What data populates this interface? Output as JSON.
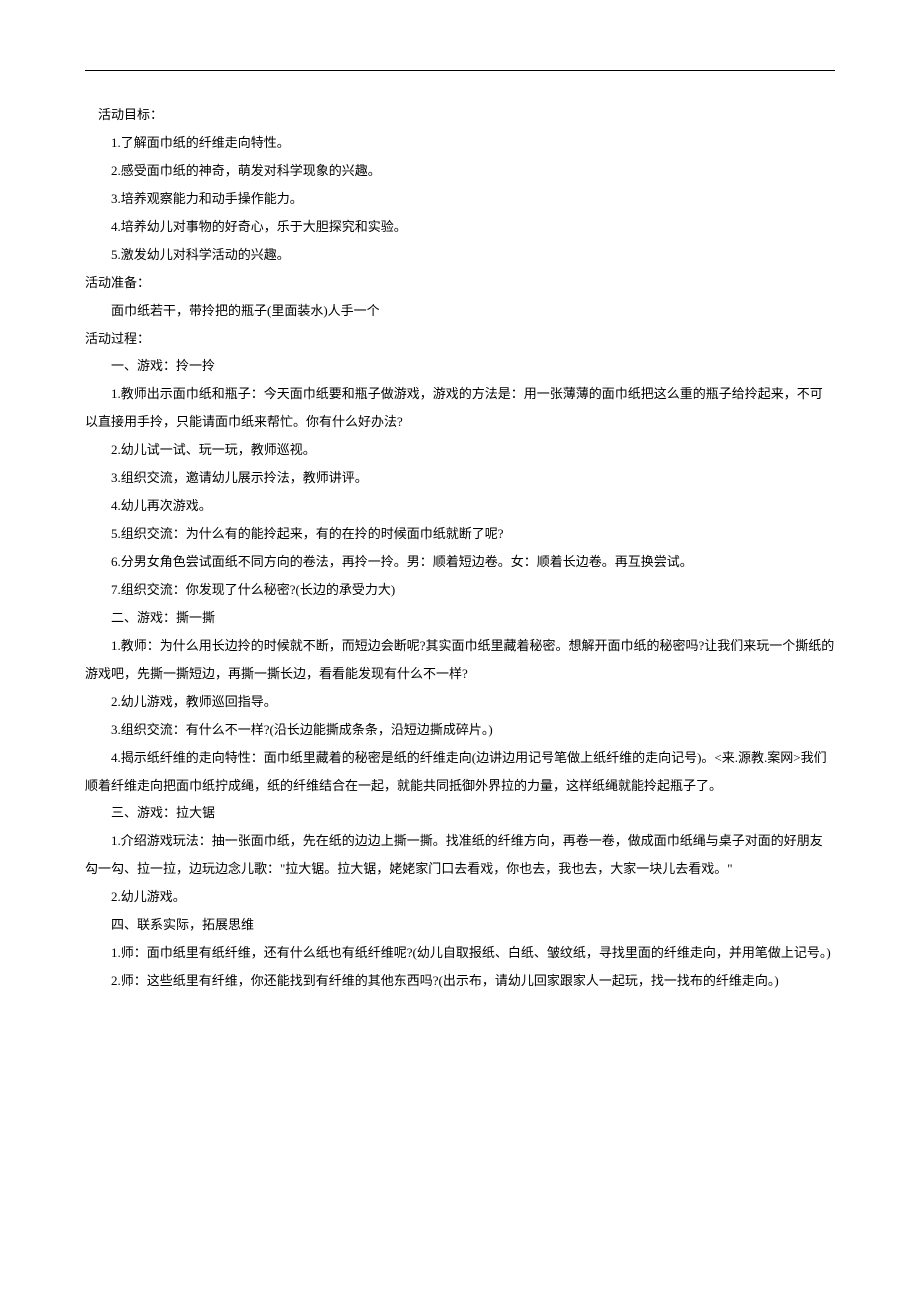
{
  "section1": {
    "title": " 活动目标：",
    "items": [
      "1.了解面巾纸的纤维走向特性。",
      "2.感受面巾纸的神奇，萌发对科学现象的兴趣。",
      "3.培养观察能力和动手操作能力。",
      "4.培养幼儿对事物的好奇心，乐于大胆探究和实验。",
      "5.激发幼儿对科学活动的兴趣。"
    ]
  },
  "section2": {
    "title": "活动准备：",
    "items": [
      "面巾纸若干，带拎把的瓶子(里面装水)人手一个"
    ]
  },
  "section3": {
    "title": "活动过程：",
    "part1": {
      "title": "一、游戏：拎一拎",
      "items": [
        "1.教师出示面巾纸和瓶子：今天面巾纸要和瓶子做游戏，游戏的方法是：用一张薄薄的面巾纸把这么重的瓶子给拎起来，不可以直接用手拎，只能请面巾纸来帮忙。你有什么好办法?",
        "2.幼儿试一试、玩一玩，教师巡视。",
        "3.组织交流，邀请幼儿展示拎法，教师讲评。",
        "4.幼儿再次游戏。",
        "5.组织交流：为什么有的能拎起来，有的在拎的时候面巾纸就断了呢?",
        "6.分男女角色尝试面纸不同方向的卷法，再拎一拎。男：顺着短边卷。女：顺着长边卷。再互换尝试。",
        "7.组织交流：你发现了什么秘密?(长边的承受力大)"
      ]
    },
    "part2": {
      "title": "二、游戏：撕一撕",
      "items": [
        "1.教师：为什么用长边拎的时候就不断，而短边会断呢?其实面巾纸里藏着秘密。想解开面巾纸的秘密吗?让我们来玩一个撕纸的游戏吧，先撕一撕短边，再撕一撕长边，看看能发现有什么不一样?",
        "2.幼儿游戏，教师巡回指导。",
        "3.组织交流：有什么不一样?(沿长边能撕成条条，沿短边撕成碎片。)",
        "4.揭示纸纤维的走向特性：面巾纸里藏着的秘密是纸的纤维走向(边讲边用记号笔做上纸纤维的走向记号)。<来.源教.案网>我们顺着纤维走向把面巾纸拧成绳，纸的纤维结合在一起，就能共同抵御外界拉的力量，这样纸绳就能拎起瓶子了。"
      ]
    },
    "part3": {
      "title": "三、游戏：拉大锯",
      "items": [
        "1.介绍游戏玩法：抽一张面巾纸，先在纸的边边上撕一撕。找准纸的纤维方向，再卷一卷，做成面巾纸绳与桌子对面的好朋友勾一勾、拉一拉，边玩边念儿歌：\"拉大锯。拉大锯，姥姥家门口去看戏，你也去，我也去，大家一块儿去看戏。\"",
        "2.幼儿游戏。"
      ]
    },
    "part4": {
      "title": "四、联系实际，拓展思维",
      "items": [
        "1.师：面巾纸里有纸纤维，还有什么纸也有纸纤维呢?(幼儿自取报纸、白纸、皱纹纸，寻找里面的纤维走向，并用笔做上记号。)",
        "2.师：这些纸里有纤维，你还能找到有纤维的其他东西吗?(出示布，请幼儿回家跟家人一起玩，找一找布的纤维走向。)"
      ]
    }
  }
}
